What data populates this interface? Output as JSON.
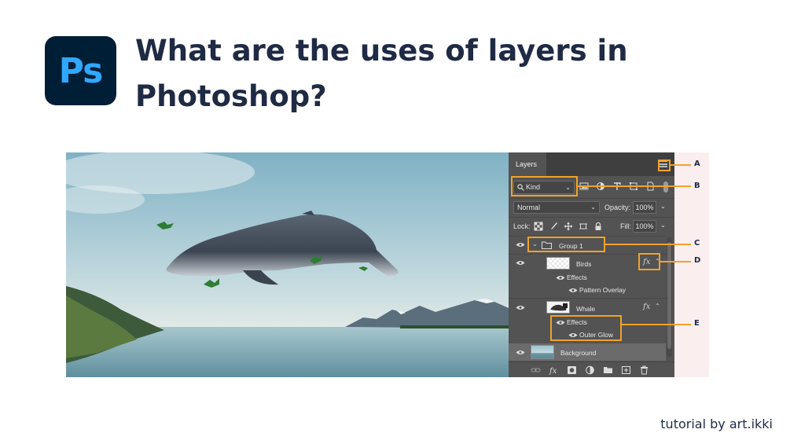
{
  "logo": {
    "text": "Ps",
    "bg": "#001e36",
    "fg": "#31a8ff"
  },
  "title": "What are the uses of layers in Photoshop?",
  "credit": "tutorial by art.ikki",
  "accent_color": "#f0a22e",
  "layers_panel": {
    "tab": "Layers",
    "menu_icon": "panel-menu-icon",
    "filter": {
      "kind_label": "Kind",
      "icons": [
        "image-filter-icon",
        "adjustment-filter-icon",
        "type-filter-icon",
        "shape-filter-icon",
        "smart-object-filter-icon"
      ]
    },
    "blend_mode": "Normal",
    "opacity_label": "Opacity:",
    "opacity_value": "100%",
    "lock_label": "Lock:",
    "lock_icons": [
      "lock-transparent-icon",
      "lock-image-icon",
      "lock-position-icon",
      "lock-artboard-icon",
      "lock-all-icon"
    ],
    "fill_label": "Fill:",
    "fill_value": "100%",
    "layers": {
      "group": "Group 1",
      "birds": "Birds",
      "birds_effects": "Effects",
      "birds_effect_1": "Pattern Overlay",
      "whale": "Whale",
      "whale_effects": "Effects",
      "whale_effect_1": "Outer Glow",
      "background": "Background"
    },
    "fx_label": "fx",
    "bottom_icons": [
      "link-layers-icon",
      "add-style-icon",
      "add-mask-icon",
      "new-adjustment-icon",
      "new-group-icon",
      "new-layer-icon",
      "delete-layer-icon"
    ]
  },
  "callouts": {
    "a": "A",
    "b": "B",
    "c": "C",
    "d": "D",
    "e": "E"
  }
}
